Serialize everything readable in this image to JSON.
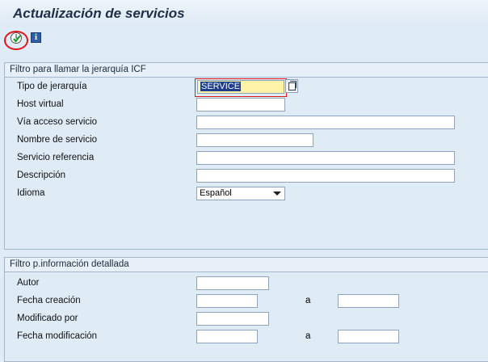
{
  "title": "Actualización de servicios",
  "toolbar": {
    "execute_icon": "execute-clock-icon",
    "info_icon": "info-icon"
  },
  "group1": {
    "title": "Filtro para llamar la jerarquía ICF",
    "fields": [
      {
        "label": "Tipo de jerarquía",
        "value": "SERVICE"
      },
      {
        "label": "Host virtual",
        "value": ""
      },
      {
        "label": "Vía acceso servicio",
        "value": ""
      },
      {
        "label": "Nombre de servicio",
        "value": ""
      },
      {
        "label": "Servicio referencia",
        "value": ""
      },
      {
        "label": "Descripción",
        "value": ""
      },
      {
        "label": "Idioma",
        "value": "Español"
      }
    ]
  },
  "group2": {
    "title": "Filtro p.información detallada",
    "fields": [
      {
        "label": "Autor",
        "value": ""
      },
      {
        "label": "Fecha creación",
        "value": "",
        "to_label": "a",
        "to_value": ""
      },
      {
        "label": "Modificado por",
        "value": ""
      },
      {
        "label": "Fecha modificación",
        "value": "",
        "to_label": "a",
        "to_value": ""
      }
    ]
  },
  "colors": {
    "background": "#dfebf5",
    "highlight": "#fff3a9",
    "annotation": "#e0161c"
  }
}
